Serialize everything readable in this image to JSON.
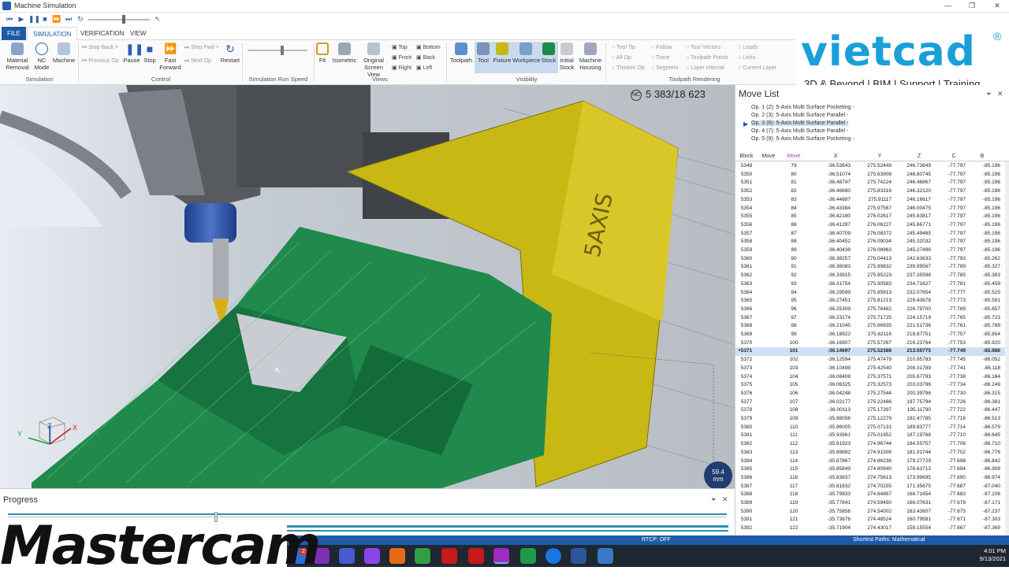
{
  "window": {
    "title": "Machine Simulation"
  },
  "menu": {
    "tabs": [
      "FILE",
      "SIMULATION",
      "VERIFICATION",
      "VIEW"
    ]
  },
  "ribbon": {
    "material_removal": "Material Removal",
    "nc_mode": "NC Mode",
    "machine": "Machine",
    "simulation_group": "Simulation",
    "step_back": "Step Back",
    "previous_op": "Previous Op",
    "pause": "Pause",
    "stop": "Stop",
    "fast_forward": "Fast Forward",
    "step_fwd": "Step Fwd",
    "next_op": "Next Op",
    "restart": "Restart",
    "control_group": "Control",
    "run_speed_group": "Simulation Run Speed",
    "fit": "Fit",
    "isometric": "Isometric",
    "original_screen_view": "Original Screen View",
    "top": "Top",
    "front": "Front",
    "right": "Right",
    "bottom": "Bottom",
    "back": "Back",
    "left": "Left",
    "views_group": "Views",
    "toolpath": "Toolpath",
    "tool": "Tool",
    "fixture": "Fixture",
    "workpiece": "Workpiece",
    "stock": "Stock",
    "initial_stock": "Initial Stock",
    "machine_housing": "Machine Housing",
    "visibility_group": "Visibility",
    "tool_tip": "Tool Tip",
    "all_op": "All Op",
    "thicken_op": "Thicken Op",
    "follow": "Follow",
    "trace": "Trace",
    "segment": "Segment",
    "tool_vectors": "Tool Vectors",
    "toolpath_points": "Toolpath Points",
    "layer_interval": "Layer Interval",
    "leads": "Leads",
    "links": "Links",
    "current_layer": "Current Layer",
    "toolpath_rendering_group": "Toolpath Rendering"
  },
  "brand": {
    "name": "vietcad",
    "tagline": "3D & Beyond | BIM | Support | Training"
  },
  "viewport": {
    "counter": "5 383/18 623",
    "nc_badge": "NC",
    "measure_value": "59.4",
    "measure_unit": "mm",
    "axis_y": "Y",
    "axis_z": "Z",
    "axis_x": "X"
  },
  "move_list": {
    "title": "Move List",
    "operations": [
      "Op. 1 (2): 5-Axis Multi Surface Pocketing -",
      "Op. 2 (3): 5-Axis Multi Surface Parallel -",
      "Op. 3 (6): 5-Axis Multi Surface Parallel -",
      "Op. 4 (7): 5-Axis Multi Surface Parallel -",
      "Op. 5 (9): 5-Axis Multi Surface Pocketing -"
    ],
    "headers": [
      "Block",
      "Move",
      "Move",
      "X",
      "Y",
      "Z",
      "C",
      "B"
    ],
    "rows": [
      [
        "5349",
        "79",
        "-36.53643",
        "275.52449",
        "246.73649",
        "-77.797",
        "-85.196"
      ],
      [
        "5350",
        "80",
        "-36.51074",
        "275.63908",
        "246.60745",
        "-77.797",
        "-85.196"
      ],
      [
        "5351",
        "81",
        "-36.48747",
        "275.74224",
        "246.46867",
        "-77.797",
        "-85.196"
      ],
      [
        "5352",
        "82",
        "-36.46680",
        "275.83316",
        "246.32120",
        "-77.797",
        "-85.196"
      ],
      [
        "5353",
        "83",
        "-36.44887",
        "275.91117",
        "246.16617",
        "-77.797",
        "-85.196"
      ],
      [
        "5354",
        "84",
        "-36.43384",
        "275.97567",
        "246.00475",
        "-77.797",
        "-85.196"
      ],
      [
        "5355",
        "85",
        "-36.42180",
        "276.02617",
        "245.83817",
        "-77.797",
        "-85.196"
      ],
      [
        "5356",
        "86",
        "-36.41287",
        "276.06227",
        "245.66771",
        "-77.797",
        "-85.196"
      ],
      [
        "5357",
        "87",
        "-36.40709",
        "276.08372",
        "245.49465",
        "-77.797",
        "-85.196"
      ],
      [
        "5358",
        "88",
        "-36.40452",
        "276.09034",
        "245.32032",
        "-77.797",
        "-85.196"
      ],
      [
        "5359",
        "89",
        "-36.40438",
        "276.08963",
        "245.27496",
        "-77.797",
        "-85.196"
      ],
      [
        "5360",
        "90",
        "-36.38257",
        "276.04413",
        "242.63633",
        "-77.793",
        "-85.262"
      ],
      [
        "5361",
        "91",
        "-36.36083",
        "275.99832",
        "239.99567",
        "-77.789",
        "-85.327"
      ],
      [
        "5362",
        "92",
        "-36.33915",
        "275.95223",
        "237.35598",
        "-77.785",
        "-85.393"
      ],
      [
        "5363",
        "93",
        "-36.31754",
        "275.90583",
        "234.71627",
        "-77.781",
        "-85.459"
      ],
      [
        "5364",
        "94",
        "-36.29599",
        "275.85913",
        "232.07654",
        "-77.777",
        "-85.525"
      ],
      [
        "5365",
        "95",
        "-36.27451",
        "275.81213",
        "229.43678",
        "-77.773",
        "-85.591"
      ],
      [
        "5366",
        "96",
        "-36.25309",
        "275.76482",
        "226.79700",
        "-77.769",
        "-85.657"
      ],
      [
        "5367",
        "97",
        "-36.23174",
        "275.71725",
        "224.15719",
        "-77.765",
        "-85.723"
      ],
      [
        "5368",
        "98",
        "-36.21045",
        "275.66935",
        "221.51736",
        "-77.761",
        "-85.789"
      ],
      [
        "5369",
        "99",
        "-36.18922",
        "275.62116",
        "218.87751",
        "-77.757",
        "-85.854"
      ],
      [
        "5370",
        "100",
        "-36.16807",
        "275.57267",
        "216.23764",
        "-77.753",
        "-85.920"
      ],
      [
        "5371",
        "101",
        "-36.14697",
        "275.52388",
        "213.59775",
        "-77.749",
        "-85.986"
      ],
      [
        "5372",
        "102",
        "-36.12594",
        "275.47479",
        "210.95783",
        "-77.745",
        "-86.052"
      ],
      [
        "5373",
        "103",
        "-36.10498",
        "275.42540",
        "208.31789",
        "-77.741",
        "-86.118"
      ],
      [
        "5374",
        "104",
        "-36.08408",
        "275.37571",
        "205.67793",
        "-77.738",
        "-86.184"
      ],
      [
        "5375",
        "105",
        "-36.06325",
        "275.32573",
        "203.03796",
        "-77.734",
        "-86.249"
      ],
      [
        "5376",
        "106",
        "-36.04248",
        "275.27544",
        "200.39796",
        "-77.730",
        "-86.315"
      ],
      [
        "5377",
        "107",
        "-36.02177",
        "275.22486",
        "197.75794",
        "-77.726",
        "-86.381"
      ],
      [
        "5378",
        "108",
        "-36.00113",
        "275.17397",
        "195.11790",
        "-77.722",
        "-86.447"
      ],
      [
        "5379",
        "109",
        "-35.98056",
        "275.12279",
        "192.47785",
        "-77.718",
        "-86.513"
      ],
      [
        "5380",
        "110",
        "-35.96005",
        "275.07131",
        "189.83777",
        "-77.714",
        "-86.579"
      ],
      [
        "5381",
        "111",
        "-35.93961",
        "275.01952",
        "187.19768",
        "-77.710",
        "-86.645"
      ],
      [
        "5382",
        "112",
        "-35.91923",
        "274.96744",
        "184.55757",
        "-77.706",
        "-86.710"
      ],
      [
        "5383",
        "113",
        "-35.89892",
        "274.91506",
        "181.91744",
        "-77.702",
        "-86.776"
      ],
      [
        "5384",
        "114",
        "-35.87867",
        "274.86238",
        "179.27729",
        "-77.698",
        "-86.842"
      ],
      [
        "5385",
        "115",
        "-35.85849",
        "274.80940",
        "176.63713",
        "-77.694",
        "-86.908"
      ],
      [
        "5386",
        "116",
        "-35.83837",
        "274.75613",
        "173.99695",
        "-77.690",
        "-86.974"
      ],
      [
        "5387",
        "117",
        "-35.81832",
        "274.70255",
        "171.35675",
        "-77.687",
        "-87.040"
      ],
      [
        "5388",
        "118",
        "-35.79833",
        "274.64867",
        "168.71654",
        "-77.683",
        "-87.106"
      ],
      [
        "5389",
        "119",
        "-35.77841",
        "274.59450",
        "166.07631",
        "-77.679",
        "-87.171"
      ],
      [
        "5390",
        "120",
        "-35.75856",
        "274.54002",
        "163.43607",
        "-77.675",
        "-87.237"
      ],
      [
        "5391",
        "121",
        "-35.73876",
        "274.48524",
        "160.79581",
        "-77.671",
        "-87.303"
      ],
      [
        "5392",
        "122",
        "-35.71904",
        "274.43017",
        "158.15554",
        "-77.667",
        "-87.369"
      ]
    ]
  },
  "progress": {
    "title": "Progress",
    "position": 0.29
  },
  "status": {
    "rtcp": "RTCP: OFF",
    "shortest_paths": "Shortest Paths: Mathematical"
  },
  "taskbar": {
    "time": "4:01 PM",
    "date": "9/13/2021",
    "badge": "2"
  },
  "mastercam": {
    "logo": "Mastercam"
  },
  "colors": {
    "accent": "#1e5aa8",
    "fixture": "#c8b814",
    "stock": "#1f8a4c",
    "brand": "#1aa0d8"
  }
}
